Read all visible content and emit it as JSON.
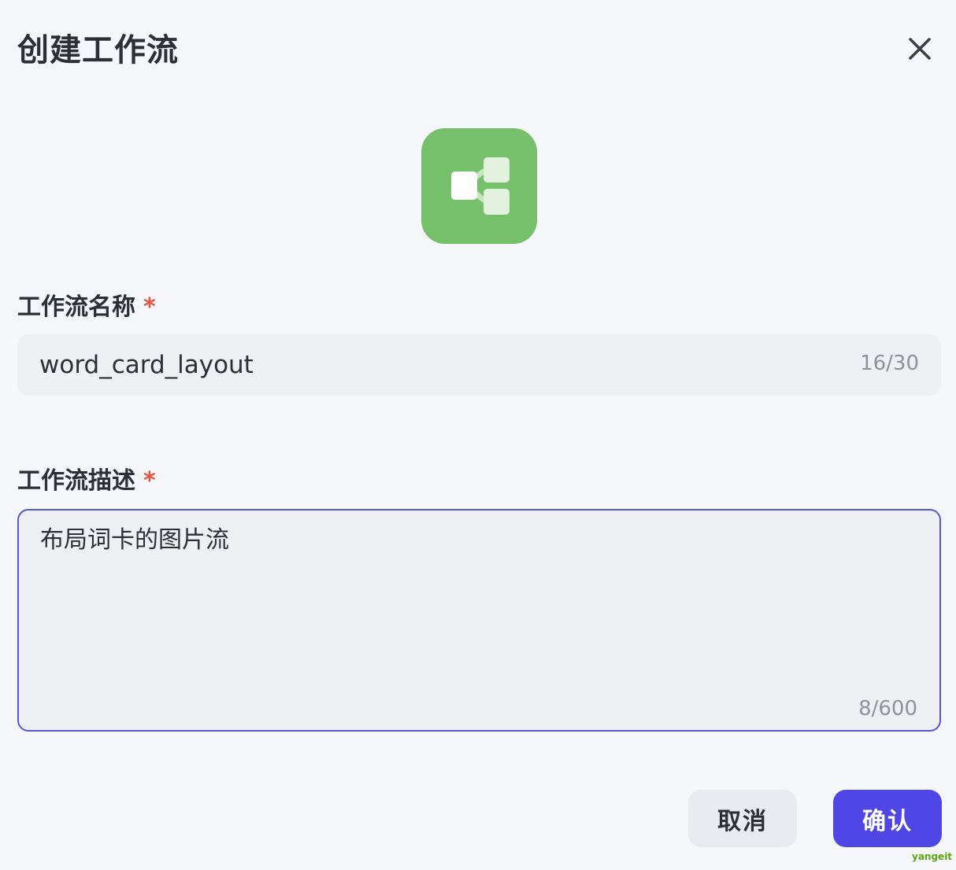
{
  "dialog": {
    "title": "创建工作流"
  },
  "icon": {
    "name": "workflow-share-icon",
    "bg_color": "#76bf6b"
  },
  "fields": {
    "name": {
      "label": "工作流名称",
      "required_mark": "*",
      "value": "word_card_layout",
      "counter": "16/30"
    },
    "description": {
      "label": "工作流描述",
      "required_mark": "*",
      "value": "布局词卡的图片流",
      "counter": "8/600"
    }
  },
  "buttons": {
    "cancel": "取消",
    "confirm": "确认"
  },
  "colors": {
    "accent": "#4f46e5",
    "required": "#e8553e",
    "focus_border": "#5a55dd"
  },
  "watermark": "yangeit"
}
